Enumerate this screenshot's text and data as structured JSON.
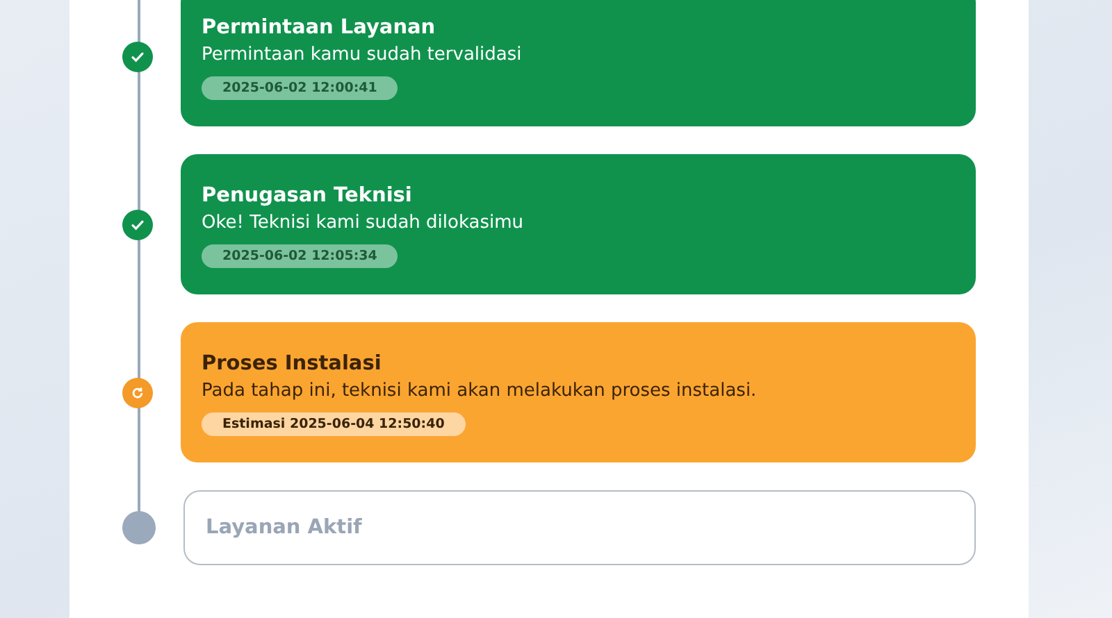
{
  "steps": [
    {
      "kind": "done",
      "title": "Permintaan Layanan",
      "description": "Permintaan kamu sudah tervalidasi",
      "time": "2025-06-02 12:00:41"
    },
    {
      "kind": "done",
      "title": "Penugasan Teknisi",
      "description": "Oke! Teknisi kami sudah dilokasimu",
      "time": "2025-06-02 12:05:34"
    },
    {
      "kind": "active",
      "title": "Proses Instalasi",
      "description": "Pada tahap ini, teknisi kami akan melakukan proses instalasi.",
      "time": "Estimasi 2025-06-04 12:50:40"
    },
    {
      "kind": "pending",
      "title": "Layanan Aktif"
    }
  ]
}
